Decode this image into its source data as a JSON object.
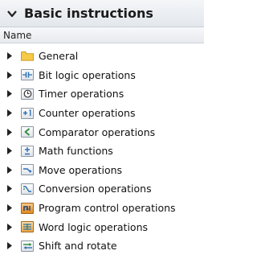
{
  "palette": {
    "expander": "#222222",
    "folder_fill": "#f7c948",
    "folder_stroke": "#c99a1c",
    "icon_orange": "#e08a1e",
    "icon_blue": "#2d6fb3",
    "icon_green": "#2f8a3c"
  },
  "panel": {
    "title": "Basic instructions",
    "collapse_icon": "chevron-down-icon"
  },
  "column_header": {
    "name": "Name"
  },
  "tree": {
    "items": [
      {
        "label": "General",
        "icon": "folder-icon"
      },
      {
        "label": "Bit logic operations",
        "icon": "bit-logic-icon"
      },
      {
        "label": "Timer operations",
        "icon": "timer-icon"
      },
      {
        "label": "Counter operations",
        "icon": "counter-icon"
      },
      {
        "label": "Comparator operations",
        "icon": "comparator-icon"
      },
      {
        "label": "Math functions",
        "icon": "math-icon"
      },
      {
        "label": "Move operations",
        "icon": "move-icon"
      },
      {
        "label": "Conversion operations",
        "icon": "conversion-icon"
      },
      {
        "label": "Program control operations",
        "icon": "program-control-icon"
      },
      {
        "label": "Word logic operations",
        "icon": "word-logic-icon"
      },
      {
        "label": "Shift and rotate",
        "icon": "shift-rotate-icon"
      }
    ]
  }
}
